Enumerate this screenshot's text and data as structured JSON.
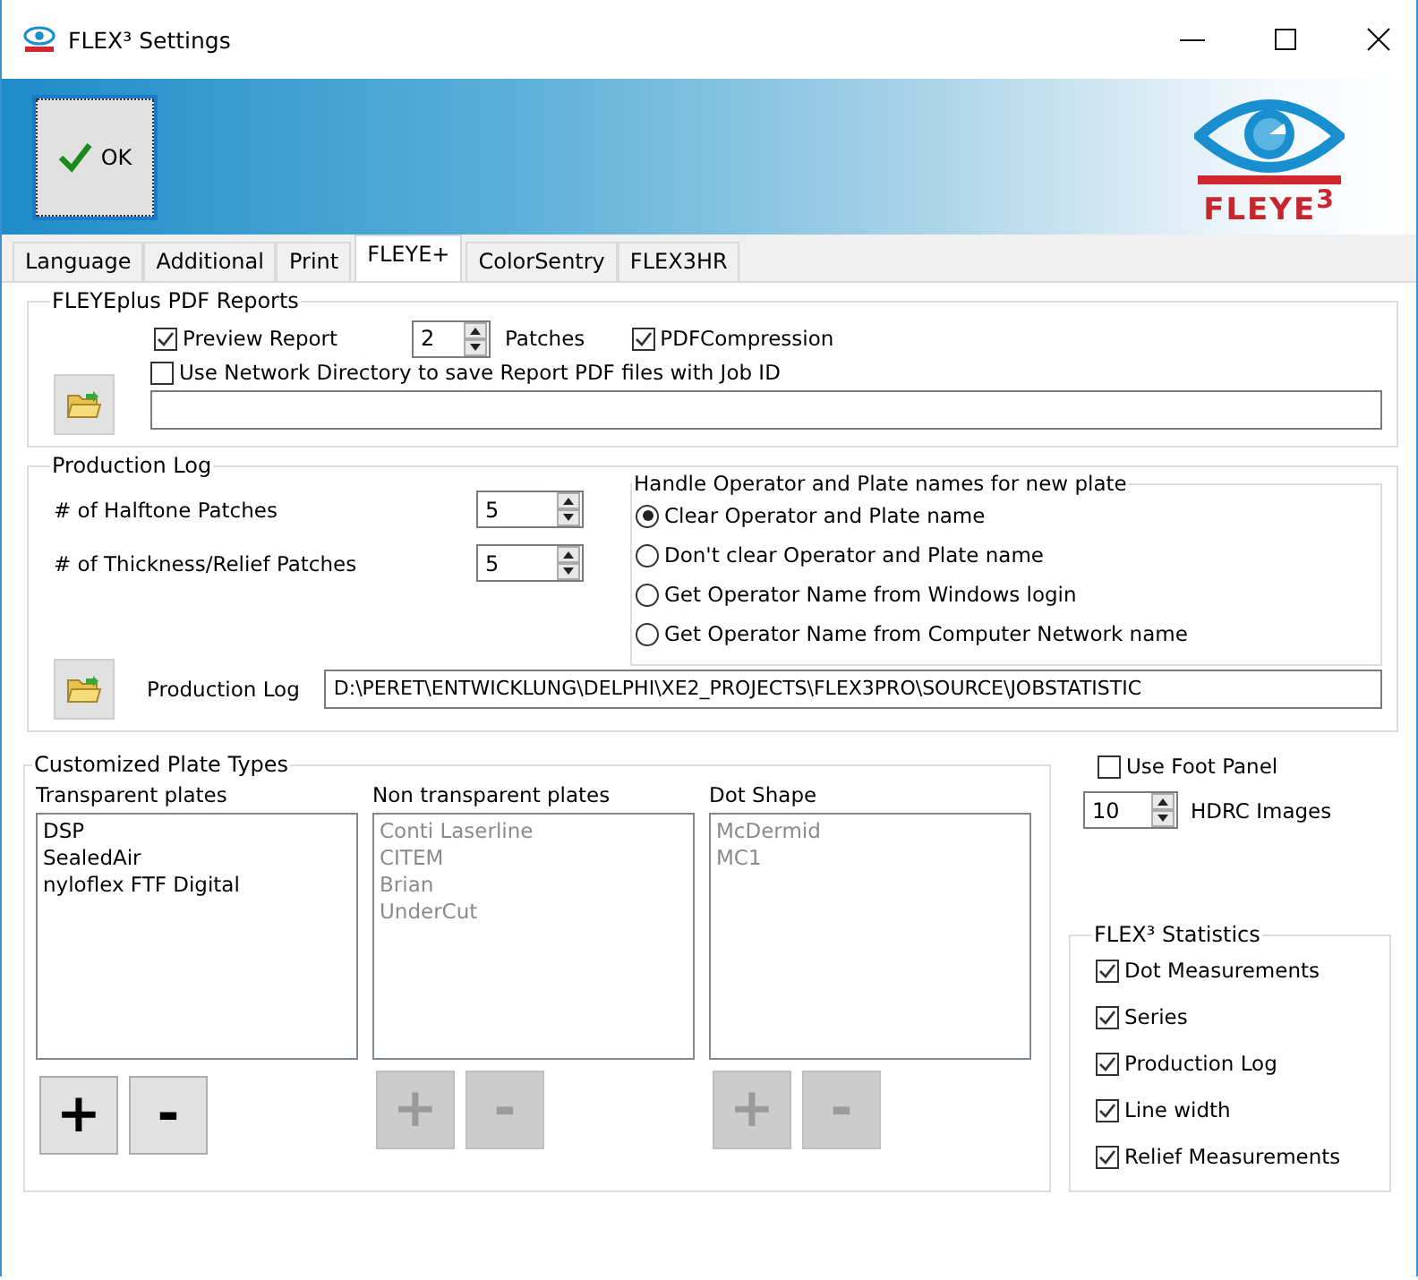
{
  "window": {
    "title": "FLEX³ Settings"
  },
  "toolbar": {
    "ok_button": "OK",
    "logo_text": "FLEYE$^{3}$"
  },
  "tabs": [
    {
      "label": "Language",
      "selected": false
    },
    {
      "label": "Additional",
      "selected": false
    },
    {
      "label": "Print",
      "selected": false
    },
    {
      "label": "FLEYE+",
      "selected": true
    },
    {
      "label": "ColorSentry",
      "selected": false
    },
    {
      "label": "FLEX3HR",
      "selected": false
    }
  ],
  "pdf_reports": {
    "title": "FLEYEplus PDF Reports",
    "preview_report": {
      "label": "Preview Report",
      "checked": true
    },
    "patches": {
      "value": "2",
      "label": "Patches"
    },
    "pdf_compression": {
      "label": "PDFCompression",
      "checked": true
    },
    "network_directory": {
      "label": "Use Network Directory to save Report PDF files with Job ID",
      "checked": false
    }
  },
  "production_log": {
    "title": "Production Log",
    "halftone": {
      "label": "# of Halftone Patches",
      "value": "5"
    },
    "thickness": {
      "label": "# of Thickness/Relief Patches",
      "value": "5"
    },
    "operator_group": {
      "title": "Handle Operator and Plate names for new plate",
      "options": [
        {
          "label": "Clear Operator and Plate name",
          "selected": true
        },
        {
          "label": "Don't clear Operator and Plate name",
          "selected": false
        },
        {
          "label": "Get Operator Name from Windows login",
          "selected": false
        },
        {
          "label": "Get Operator Name from Computer Network name",
          "selected": false
        }
      ]
    },
    "log_path": {
      "label": "Production Log",
      "value": "D:\\PERET\\ENTWICKLUNG\\DELPHI\\XE2_PROJECTS\\FLEX3PRO\\SOURCE\\JOBSTATISTIC"
    }
  },
  "plate_types": {
    "title": "Customized Plate Types",
    "lists": [
      {
        "title": "Transparent plates",
        "disabled": false,
        "items": [
          "DSP",
          "SealedAir",
          "nyloflex FTF Digital"
        ],
        "add_button": "+",
        "remove_button": "-"
      },
      {
        "title": "Non transparent plates",
        "disabled": true,
        "items": [
          "Conti Laserline",
          "CITEM",
          "Brian",
          "UnderCut"
        ],
        "add_button": "+",
        "remove_button": "-"
      },
      {
        "title": "Dot Shape",
        "disabled": true,
        "items": [
          "McDermid",
          "MC1"
        ],
        "add_button": "+",
        "remove_button": "-"
      }
    ]
  },
  "foot_panel": {
    "label": "Use Foot Panel",
    "checked": false
  },
  "hdrc": {
    "value": "10",
    "label": "HDRC Images"
  },
  "statistics": {
    "title": "FLEX³ Statistics",
    "options": [
      {
        "label": "Dot Measurements",
        "checked": true
      },
      {
        "label": "Series",
        "checked": true
      },
      {
        "label": "Production Log",
        "checked": true
      },
      {
        "label": "Line width",
        "checked": true
      },
      {
        "label": "Relief Measurements",
        "checked": true
      }
    ]
  }
}
